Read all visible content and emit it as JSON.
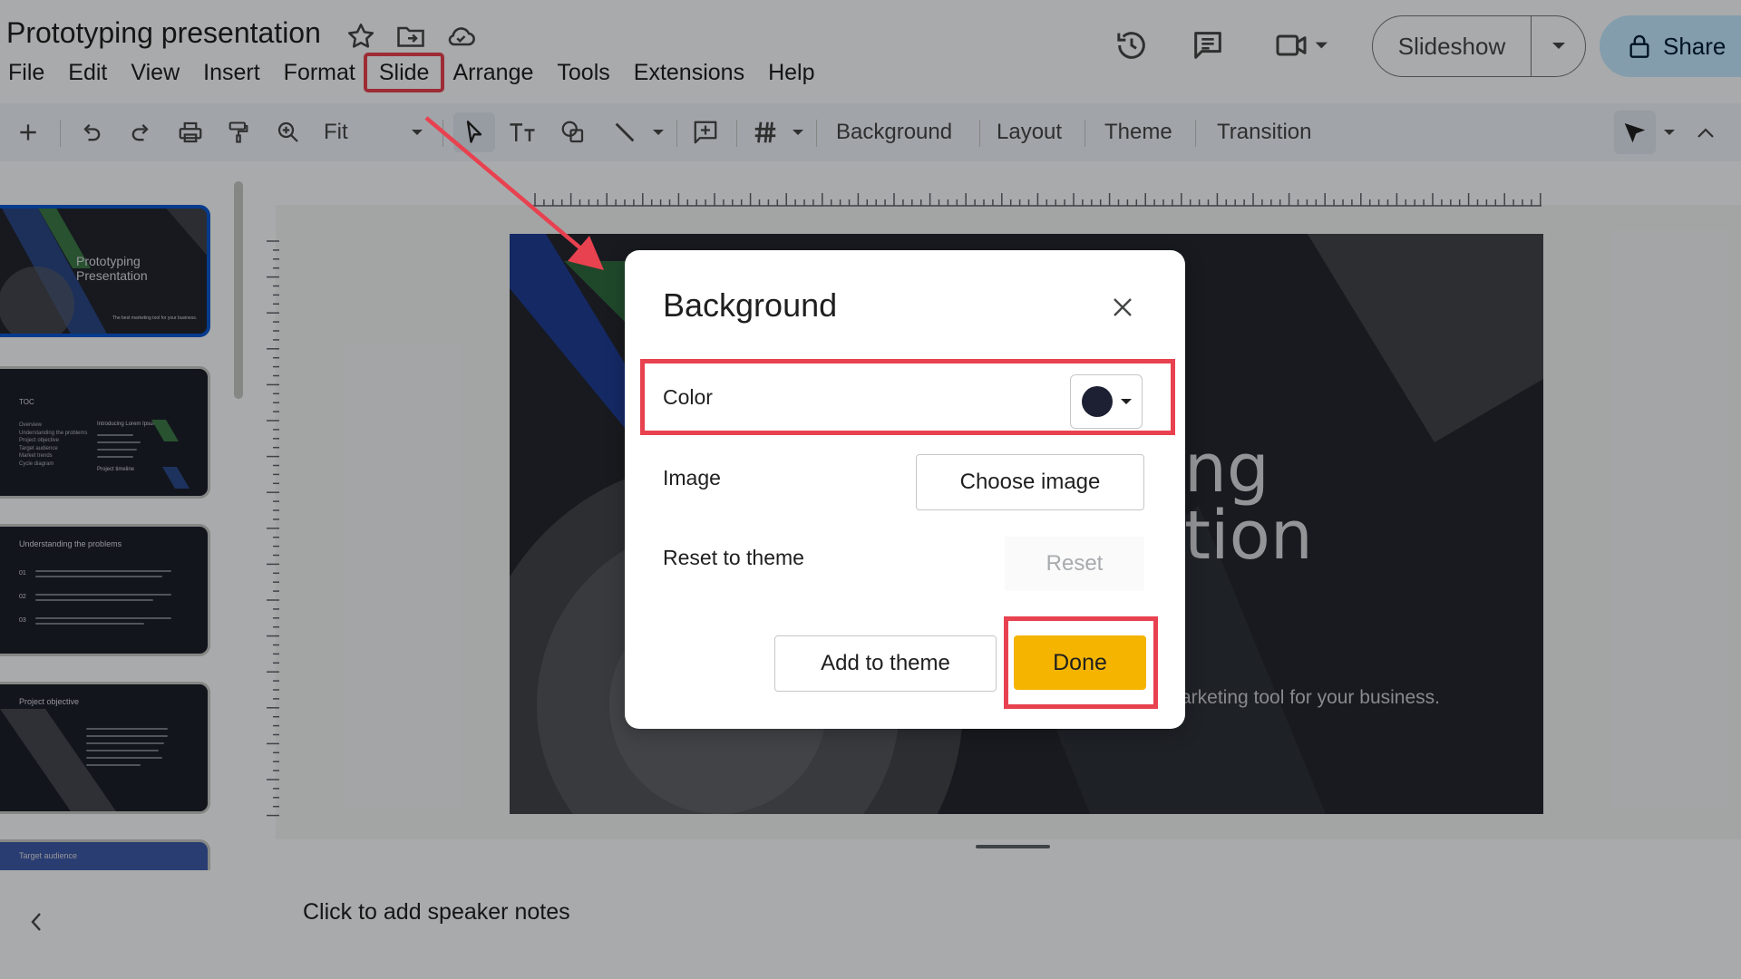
{
  "header": {
    "title": "Prototyping presentation",
    "slideshow_label": "Slideshow",
    "share_label": "Share"
  },
  "menu": [
    "File",
    "Edit",
    "View",
    "Insert",
    "Format",
    "Slide",
    "Arrange",
    "Tools",
    "Extensions",
    "Help"
  ],
  "toolbar": {
    "zoom_label": "Fit",
    "background_label": "Background",
    "layout_label": "Layout",
    "theme_label": "Theme",
    "transition_label": "Transition"
  },
  "thumbnails": [
    {
      "title": "Prototyping Presentation",
      "subtitle": "The best marketing tool for your business."
    },
    {
      "title": "TOC",
      "items": [
        "Overview",
        "Understanding the problems",
        "Project objective",
        "Target audience",
        "Market trends",
        "Cycle diagram"
      ],
      "right_title": "Introducing Lorem Ipsum",
      "right_footer": "Project timeline"
    },
    {
      "title": "Understanding the problems",
      "numbers": [
        "01",
        "02",
        "03"
      ]
    },
    {
      "title": "Project objective"
    },
    {
      "title": "Target audience"
    }
  ],
  "slide": {
    "line1": "ng",
    "line2": "tion",
    "subtitle": "arketing tool for your business."
  },
  "notes": {
    "placeholder": "Click to add speaker notes"
  },
  "dialog": {
    "title": "Background",
    "color_label": "Color",
    "color_value": "#1c2032",
    "image_label": "Image",
    "choose_image_label": "Choose image",
    "reset_label": "Reset to theme",
    "reset_button": "Reset",
    "add_to_theme": "Add to theme",
    "done": "Done"
  },
  "colors": {
    "annotation": "#e8414f",
    "done": "#f4b400",
    "share": "#c2e7ff"
  }
}
